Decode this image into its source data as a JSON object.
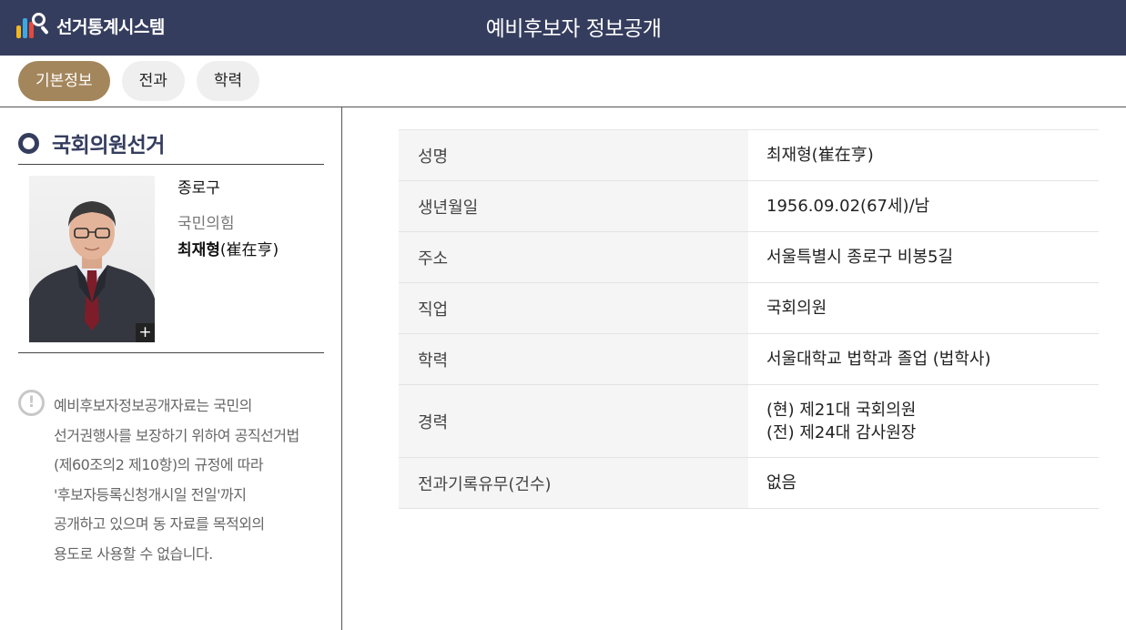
{
  "header": {
    "app_name": "선거통계시스템",
    "title": "예비후보자 정보공개"
  },
  "tabs": [
    {
      "label": "기본정보",
      "active": true
    },
    {
      "label": "전과",
      "active": false
    },
    {
      "label": "학력",
      "active": false
    }
  ],
  "election": {
    "section_title": "국회의원선거",
    "district": "종로구",
    "party": "국민의힘",
    "candidate_name": "최재형",
    "candidate_hanja": "(崔在亨)",
    "zoom_label": "+"
  },
  "notice": {
    "icon": "!",
    "lines": [
      "예비후보자정보공개자료는 국민의",
      "선거권행사를 보장하기 위하여 공직선거법",
      "(제60조의2 제10항)의 규정에 따라",
      "'후보자등록신청개시일 전일'까지",
      "공개하고 있으며 동 자료를 목적외의",
      "용도로 사용할 수 없습니다."
    ]
  },
  "details": [
    {
      "label": "성명",
      "value": [
        "최재형(崔在亨)"
      ]
    },
    {
      "label": "생년월일",
      "value": [
        "1956.09.02(67세)/남"
      ]
    },
    {
      "label": "주소",
      "value": [
        "서울특별시 종로구 비봉5길"
      ]
    },
    {
      "label": "직업",
      "value": [
        "국회의원"
      ]
    },
    {
      "label": "학력",
      "value": [
        "서울대학교 법학과 졸업 (법학사)"
      ]
    },
    {
      "label": "경력",
      "value": [
        "(현) 제21대 국회의원",
        "(전) 제24대 감사원장"
      ]
    },
    {
      "label": "전과기록유무(건수)",
      "value": [
        "없음"
      ]
    }
  ],
  "colors": {
    "header_bg": "#353d5e",
    "tab_active": "#a3865c",
    "tab_inactive": "#efefef"
  }
}
